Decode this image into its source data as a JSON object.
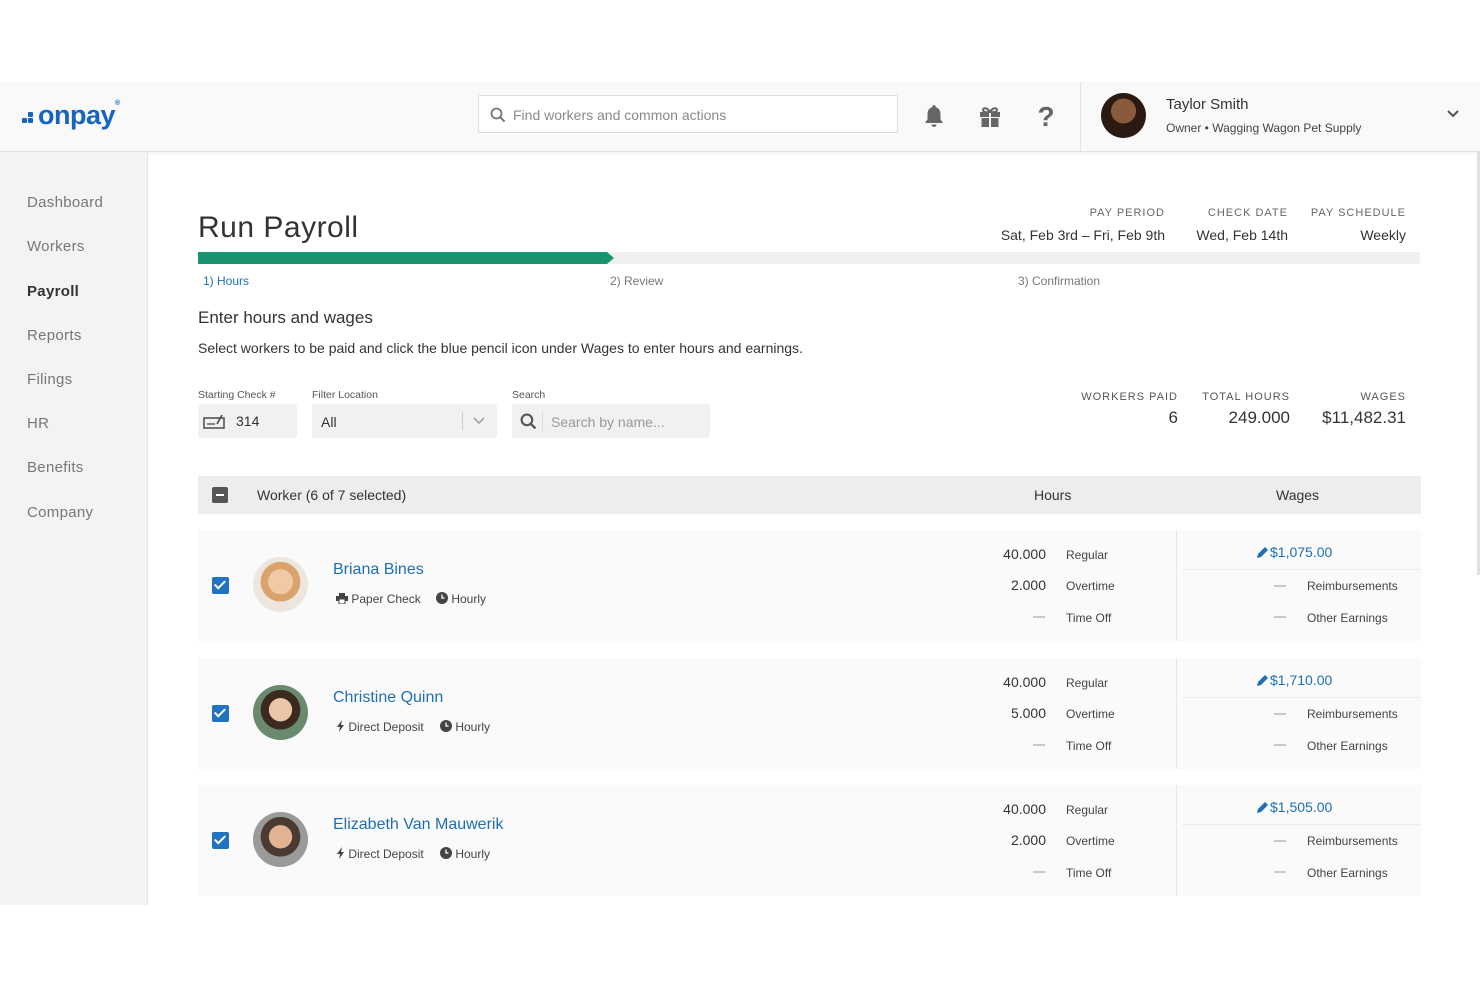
{
  "brand": {
    "logo_text": "onpay",
    "accent": "#1565c0",
    "progress_color": "#1a9470",
    "link_color": "#1f6fb3"
  },
  "header": {
    "search_placeholder": "Find workers and common actions",
    "icons": [
      "bell-icon",
      "gift-icon",
      "help-icon"
    ],
    "user_name": "Taylor Smith",
    "user_role": "Owner • Wagging Wagon Pet Supply"
  },
  "sidebar": {
    "items": [
      {
        "label": "Dashboard"
      },
      {
        "label": "Workers"
      },
      {
        "label": "Payroll",
        "active": true
      },
      {
        "label": "Reports"
      },
      {
        "label": "Filings"
      },
      {
        "label": "HR"
      },
      {
        "label": "Benefits"
      },
      {
        "label": "Company"
      }
    ]
  },
  "page": {
    "title": "Run Payroll",
    "pay_period_label": "PAY PERIOD",
    "pay_period": "Sat, Feb 3rd – Fri, Feb 9th",
    "check_date_label": "CHECK DATE",
    "check_date": "Wed, Feb 14th",
    "pay_schedule_label": "PAY SCHEDULE",
    "pay_schedule": "Weekly",
    "progress_fraction": 0.335,
    "steps": [
      "1) Hours",
      "2) Review",
      "3) Confirmation"
    ],
    "section_title": "Enter hours and wages",
    "instructions": "Select workers to be paid and click the blue pencil icon under Wages to enter hours and earnings."
  },
  "filters": {
    "starting_check_label": "Starting Check #",
    "starting_check_value": "314",
    "location_label": "Filter Location",
    "location_value": "All",
    "search_label": "Search",
    "search_placeholder": "Search by name..."
  },
  "stats": {
    "workers_paid_label": "WORKERS PAID",
    "workers_paid": "6",
    "total_hours_label": "TOTAL HOURS",
    "total_hours": "249.000",
    "wages_label": "WAGES",
    "wages": "$11,482.31"
  },
  "table": {
    "worker_header": "Worker (6 of 7 selected)",
    "hours_header": "Hours",
    "wages_header": "Wages",
    "hour_labels": [
      "Regular",
      "Overtime",
      "Time Off"
    ],
    "wage_labels": [
      "Reimbursements",
      "Other Earnings"
    ],
    "rows": [
      {
        "name": "Briana Bines",
        "pay_method": "Paper Check",
        "pay_type": "Hourly",
        "regular": "40.000",
        "overtime": "2.000",
        "wage": "$1,075.00"
      },
      {
        "name": "Christine Quinn",
        "pay_method": "Direct Deposit",
        "pay_type": "Hourly",
        "regular": "40.000",
        "overtime": "5.000",
        "wage": "$1,710.00"
      },
      {
        "name": "Elizabeth Van Mauwerik",
        "pay_method": "Direct Deposit",
        "pay_type": "Hourly",
        "regular": "40.000",
        "overtime": "2.000",
        "wage": "$1,505.00"
      }
    ]
  }
}
